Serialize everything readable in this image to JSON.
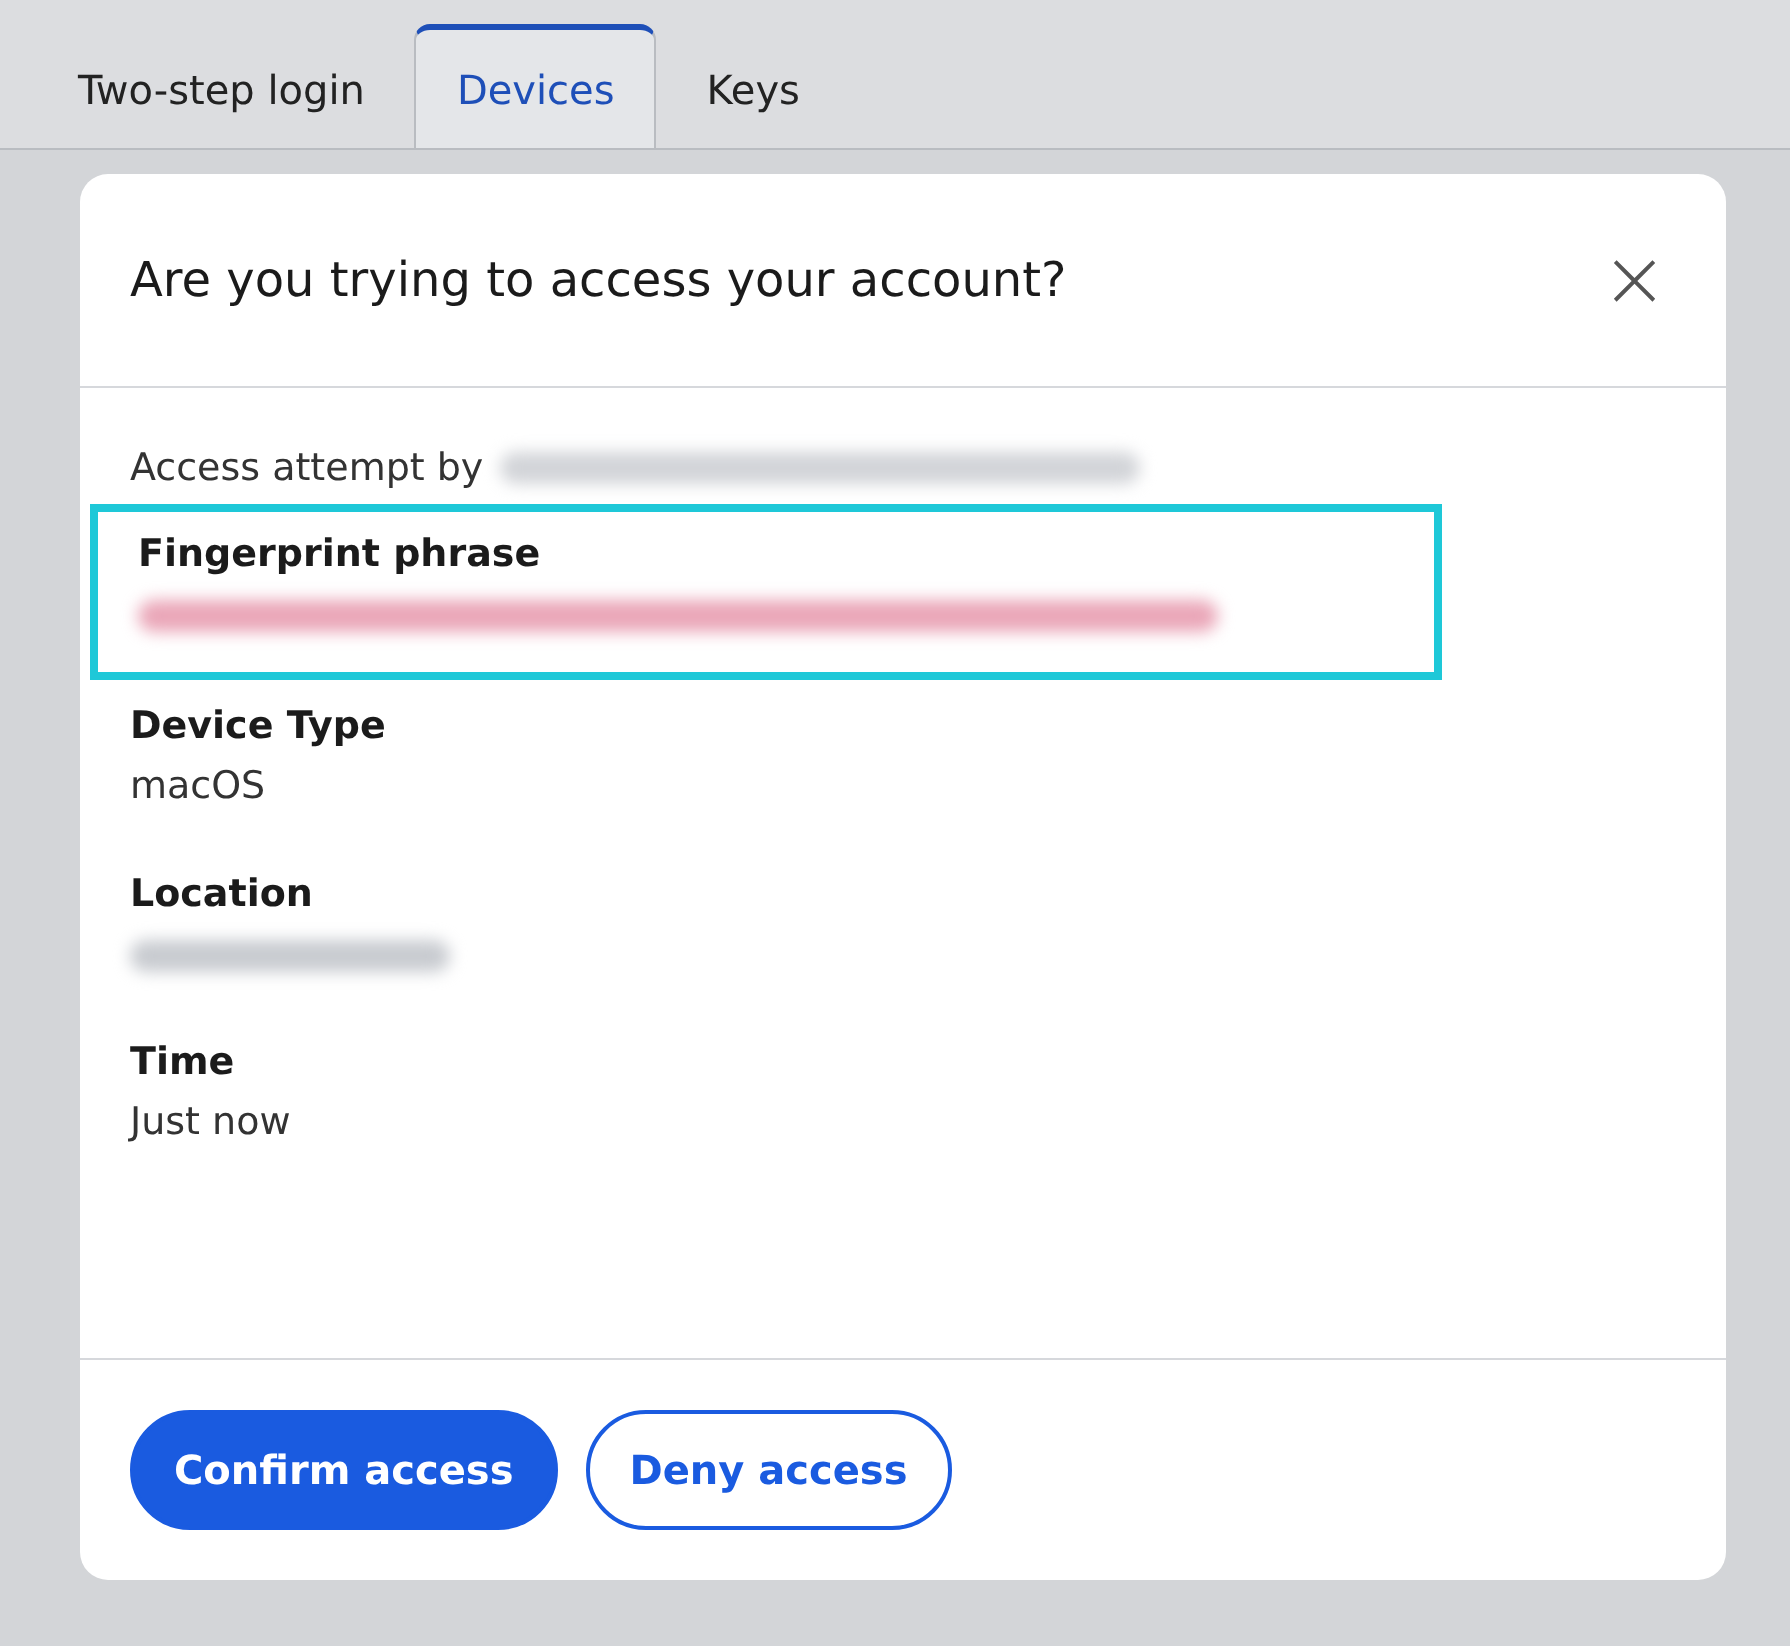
{
  "tabs": [
    {
      "label": "Two-step login",
      "selected": false
    },
    {
      "label": "Devices",
      "selected": true
    },
    {
      "label": "Keys",
      "selected": false
    }
  ],
  "dialog": {
    "title": "Are you trying to access your account?",
    "close": "×",
    "attempt": {
      "label": "Access attempt by"
    },
    "fields": [
      {
        "label": "Fingerprint phrase",
        "kind": "redacted",
        "color": "#eaa6b8",
        "highlighted": true
      },
      {
        "label": "Device Type",
        "kind": "text",
        "value": "macOS",
        "highlighted": false
      },
      {
        "label": "Location",
        "kind": "redacted",
        "color": "#c8cbd0",
        "highlighted": false
      },
      {
        "label": "Time",
        "kind": "text",
        "value": "Just now",
        "highlighted": false
      }
    ],
    "buttons": [
      {
        "label": "Confirm access",
        "kind": "primary"
      },
      {
        "label": "Deny access",
        "kind": "secondary"
      }
    ]
  }
}
